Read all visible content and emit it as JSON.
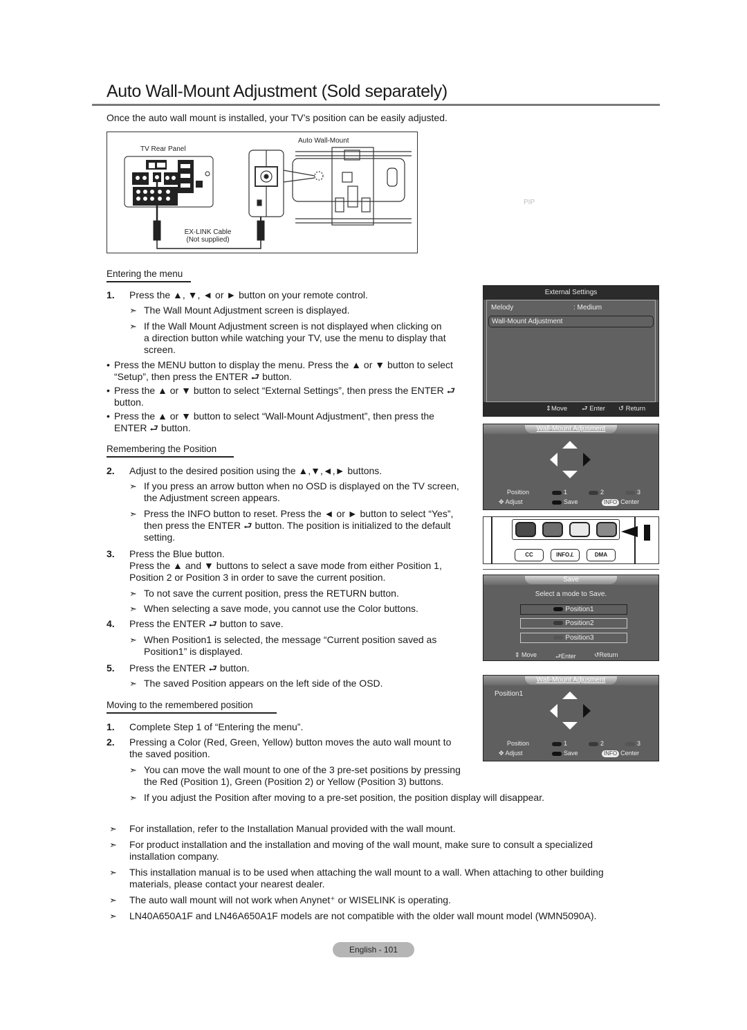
{
  "page": {
    "title": "Auto Wall-Mount Adjustment (Sold separately)",
    "intro": "Once the auto wall mount is installed, your TV’s position can be easily adjusted.",
    "pip_label": "PIP",
    "footer": "English - 101"
  },
  "diagram": {
    "tv_rear_panel": "TV Rear Panel",
    "auto_wall_mount": "Auto Wall-Mount",
    "cable_line1": "EX-LINK Cable",
    "cable_line2": "(Not supplied)"
  },
  "sections": {
    "entering": {
      "heading": "Entering the menu",
      "step1_num": "1.",
      "step1": "Press the ▲, ▼, ◄ or ► button on your remote control.",
      "note1": "The Wall Mount Adjustment screen is displayed.",
      "note2_l1": "If the Wall Mount Adjustment screen is not displayed when clicking on",
      "note2_l2": "a direction button while watching your TV, use the menu to display that",
      "note2_l3": "screen.",
      "bullet1_l1": "Press the MENU button to display the menu. Press the ▲ or ▼ button to select",
      "bullet1_l2": "“Setup”, then press the ENTER ⮐ button.",
      "bullet2_l1": "Press the ▲ or ▼ button to select “External Settings”, then press the ENTER ⮐",
      "bullet2_l2": "button.",
      "bullet3_l1": "Press the ▲ or ▼ button to select “Wall-Mount Adjustment”, then press the",
      "bullet3_l2": "ENTER ⮐ button."
    },
    "remembering": {
      "heading": "Remembering the Position",
      "step2_num": "2.",
      "step2": "Adjust to the desired position using the ▲,▼,◄,► buttons.",
      "note1_l1": "If you press an arrow button when no OSD is displayed on the TV screen,",
      "note1_l2": "the Adjustment screen appears.",
      "note2_l1": "Press the INFO button to reset. Press the ◄ or ► button to select “Yes”,",
      "note2_l2": "then press the ENTER ⮐ button. The position is initialized to the default",
      "note2_l3": "setting.",
      "step3_num": "3.",
      "step3_l1": "Press the Blue button.",
      "step3_l2": "Press the ▲ and ▼ buttons to select a save mode from either Position 1,",
      "step3_l3": "Position 2 or Position 3 in order to save the current position.",
      "note3": "To not save the current position, press the RETURN button.",
      "note4": "When selecting a save mode, you cannot use the Color buttons.",
      "step4_num": "4.",
      "step4": "Press the ENTER ⮐ button to save.",
      "note5_l1": "When Position1 is selected, the message “Current position saved as",
      "note5_l2": "Position1” is displayed.",
      "step5_num": "5.",
      "step5": "Press the ENTER ⮐ button.",
      "note6": "The saved Position appears on the left side of the OSD."
    },
    "moving": {
      "heading": "Moving to the remembered position",
      "step1_num": "1.",
      "step1": "Complete Step 1 of “Entering the menu”.",
      "step2_num": "2.",
      "step2_l1": "Pressing a Color (Red, Green, Yellow) button moves the auto wall mount to",
      "step2_l2": "the saved position.",
      "note1_l1": "You can move the wall mount to one of the 3 pre-set positions by pressing",
      "note1_l2": "the Red (Position 1), Green (Position 2) or Yellow (Position 3) buttons.",
      "note2": "If you adjust the Position after moving to a pre-set position, the position display will disappear."
    },
    "general_notes": [
      {
        "l1": "For installation, refer to the Installation Manual provided with the wall mount.",
        "l2": ""
      },
      {
        "l1": "For product installation and the installation and moving of the wall mount, make sure to consult a specialized",
        "l2": "installation company."
      },
      {
        "l1": "This installation manual is to be used when attaching the wall mount to a wall. When attaching to other building",
        "l2": "materials, please contact your nearest dealer."
      },
      {
        "l1": "The auto wall mount will not work when Anynet⁺ or WISELINK is operating.",
        "l2": ""
      },
      {
        "l1": "LN40A650A1F and LN46A650A1F models are not compatible with the older wall mount model (WMN5090A).",
        "l2": ""
      }
    ],
    "note_glyph": "➣",
    "bullet_glyph": "•"
  },
  "osd_external": {
    "title": "External Settings",
    "items": [
      {
        "label": "Melody",
        "value": ": Medium"
      },
      {
        "label": "Wall-Mount Adjustment",
        "value": ""
      }
    ],
    "footer": {
      "move": "Move",
      "enter": "Enter",
      "return": "Return"
    }
  },
  "osd_adjust": {
    "title": "Wall-Mount Adjusment",
    "position_label": "Position",
    "positions": [
      "1",
      "2",
      "3"
    ],
    "adjust": "Adjust",
    "save": "Save",
    "info": "INFO",
    "center": "Center"
  },
  "remote": {
    "buttons": [
      "CC",
      "INFO.𝘓",
      "DMA"
    ]
  },
  "osd_save": {
    "title": "Save",
    "prompt": "Select a mode to Save.",
    "options": [
      "Position1",
      "Position2",
      "Position3"
    ],
    "footer": {
      "move": "Move",
      "enter": "Enter",
      "return": "Return"
    }
  },
  "osd_adjust2": {
    "title": "Wall-Mount Adjusment",
    "saved_position": "Position1",
    "position_label": "Position",
    "positions": [
      "1",
      "2",
      "3"
    ],
    "adjust": "Adjust",
    "save": "Save",
    "info": "INFO",
    "center": "Center"
  },
  "colors": {
    "osd_bg": "#5f5f5f",
    "osd_bar": "#2b2b2b",
    "rule": "#7a7a7a",
    "footer_pill": "#b5b5b5"
  }
}
